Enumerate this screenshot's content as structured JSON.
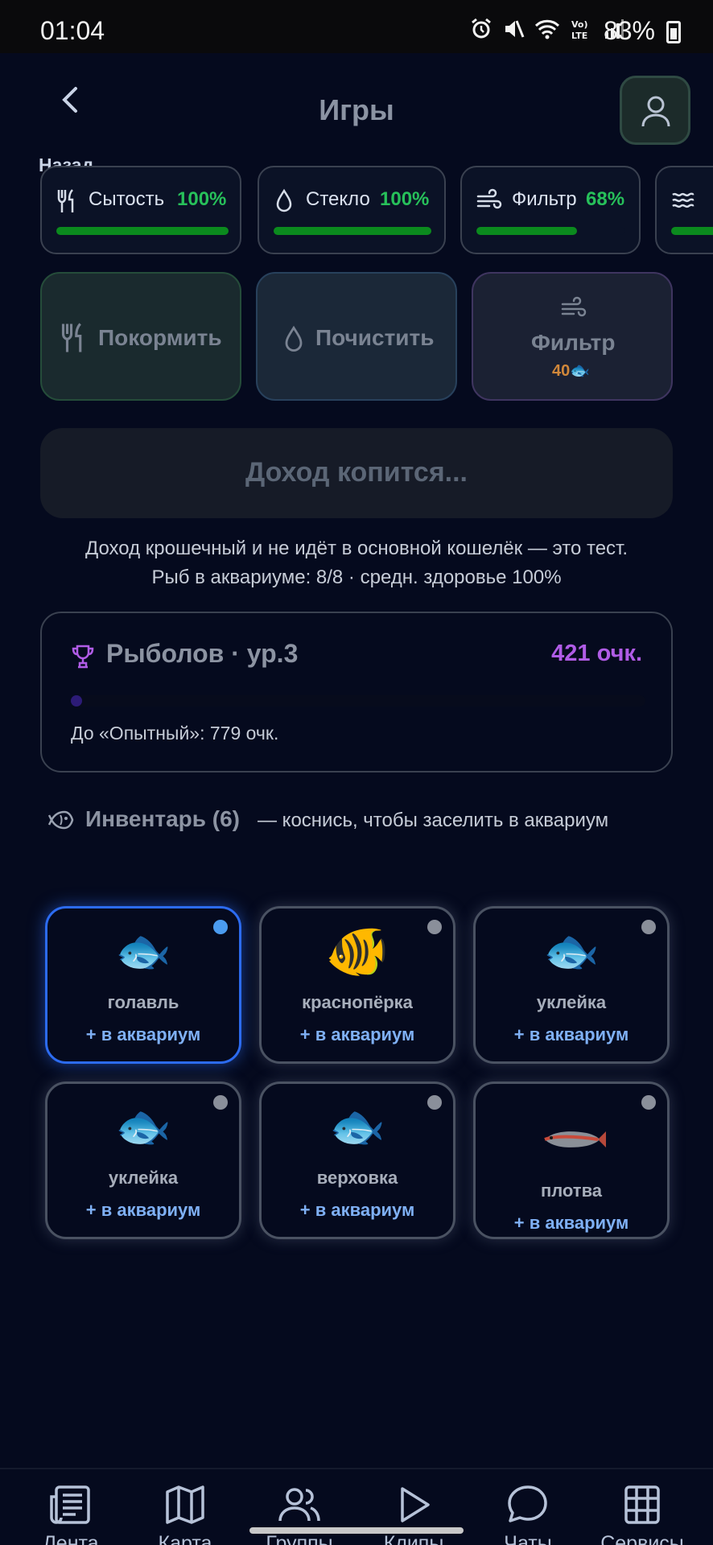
{
  "status_bar": {
    "time": "01:04",
    "battery": "83%"
  },
  "header": {
    "back_label": "Назад",
    "title": "Игры"
  },
  "stats": [
    {
      "name": "Сытость",
      "value": "100%",
      "level": 1.0,
      "icon": "fork-knife-icon"
    },
    {
      "name": "Стекло",
      "value": "100%",
      "level": 1.0,
      "icon": "drop-icon"
    },
    {
      "name": "Фильтр",
      "value": "68%",
      "level": 0.68,
      "icon": "wind-icon"
    }
  ],
  "actions": {
    "feed": "Покормить",
    "clean": "Почистить",
    "filter": "Фильтр",
    "filter_cost": "40🐟"
  },
  "income": {
    "label": "Доход копится..."
  },
  "notes": {
    "line1": "Доход крошечный и не идёт в основной кошелёк — это тест.",
    "line2": "Рыб в аквариуме: 8/8 · средн. здоровье 100%"
  },
  "level": {
    "title": "Рыболов · ур.3",
    "score": "421 очк.",
    "progress": 0.02,
    "next": "До «Опытный»: 779 очк."
  },
  "inventory": {
    "title": "Инвентарь (6)",
    "hint": "— коснись, чтобы заселить в аквариум",
    "add_label": "+ в аквариум",
    "items": [
      {
        "name": "голавль",
        "emoji": "🐟",
        "selected": true
      },
      {
        "name": "краснопёрка",
        "emoji": "🐠",
        "selected": false
      },
      {
        "name": "уклейка",
        "emoji": "🐟",
        "selected": false
      },
      {
        "name": "уклейка",
        "emoji": "🐟",
        "selected": false
      },
      {
        "name": "верховка",
        "emoji": "🐟",
        "selected": false
      },
      {
        "name": "плотва",
        "emoji": "🐟",
        "selected": false
      }
    ]
  },
  "tabbar": [
    {
      "label": "Лента",
      "icon": "newspaper-icon"
    },
    {
      "label": "Карта",
      "icon": "map-icon"
    },
    {
      "label": "Группы",
      "icon": "people-icon"
    },
    {
      "label": "Клипы",
      "icon": "play-icon"
    },
    {
      "label": "Чаты",
      "icon": "chat-bubble-icon"
    },
    {
      "label": "Сервисы",
      "icon": "grid-icon"
    }
  ]
}
